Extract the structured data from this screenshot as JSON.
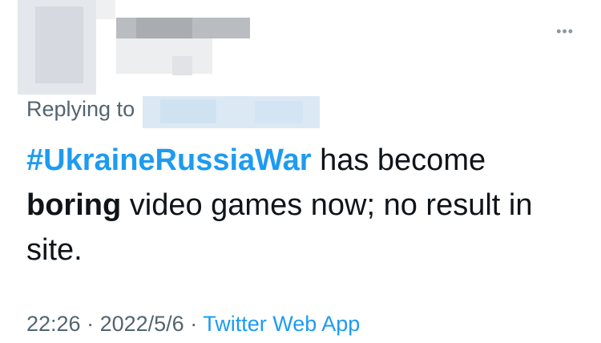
{
  "tweet": {
    "more_icon": "•••",
    "replying_to_label": "Replying to",
    "hashtag": "#UkraineRussiaWar",
    "text_part1": " has become ",
    "bold_word": "boring",
    "text_part2": " video games now; no result in site.",
    "time": "22:26",
    "sep1": " · ",
    "date": "2022/5/6",
    "sep2": " · ",
    "source": "Twitter Web App",
    "accent_color": "#1d9bf0"
  }
}
